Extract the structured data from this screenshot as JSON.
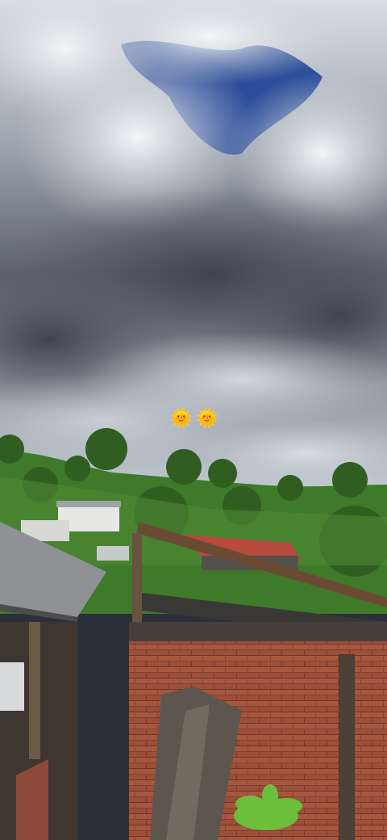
{
  "scene": {
    "kind": "photo",
    "description_hidden": true
  },
  "stickers": [
    {
      "icon": "sun-with-face-icon",
      "glyph": "🌞"
    },
    {
      "icon": "sun-with-face-icon",
      "glyph": "🌞"
    }
  ],
  "colors": {
    "sky_blue": "#2c4e9a",
    "cloud_light": "#e9ecef",
    "cloud_dark": "#4e5560",
    "vegetation": "#3f7a2b",
    "brick": "#a5523b",
    "roof": "#b64a3c"
  }
}
